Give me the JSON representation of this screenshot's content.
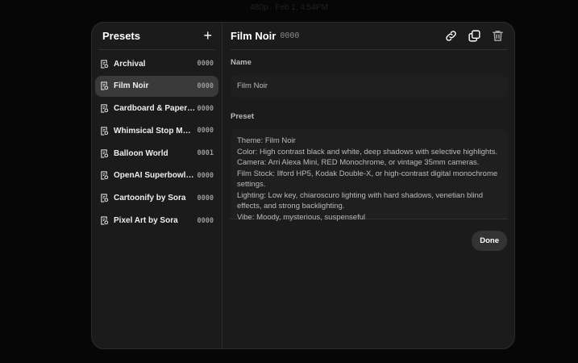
{
  "background_text": "480p · Feb 1, 4:54PM",
  "sidebar": {
    "title": "Presets",
    "add_icon": "plus-icon",
    "items": [
      {
        "label": "Archival",
        "count": "0000"
      },
      {
        "label": "Film Noir",
        "count": "0000",
        "selected": true
      },
      {
        "label": "Cardboard & Papercraft",
        "count": "0000"
      },
      {
        "label": "Whimsical Stop Motion",
        "count": "0000"
      },
      {
        "label": "Balloon World",
        "count": "0001"
      },
      {
        "label": "OpenAI Superbowl C...",
        "count": "0000"
      },
      {
        "label": "Cartoonify by Sora",
        "count": "0000"
      },
      {
        "label": "Pixel Art by Sora",
        "count": "0000"
      }
    ]
  },
  "main": {
    "title": "Film Noir",
    "count": "0000",
    "name_label": "Name",
    "name_value": "Film Noir",
    "preset_label": "Preset",
    "preset_value": "Theme: Film Noir\nColor: High contrast black and white, deep shadows with selective highlights.\nCamera: Arri Alexa Mini, RED Monochrome, or vintage 35mm cameras.\nFilm Stock: Ilford HP5, Kodak Double-X, or high-contrast digital monochrome settings.\nLighting: Low key, chiaroscuro lighting with hard shadows, venetian blind effects, and strong backlighting.\nVibe: Moody, mysterious, suspenseful",
    "done_label": "Done"
  }
}
